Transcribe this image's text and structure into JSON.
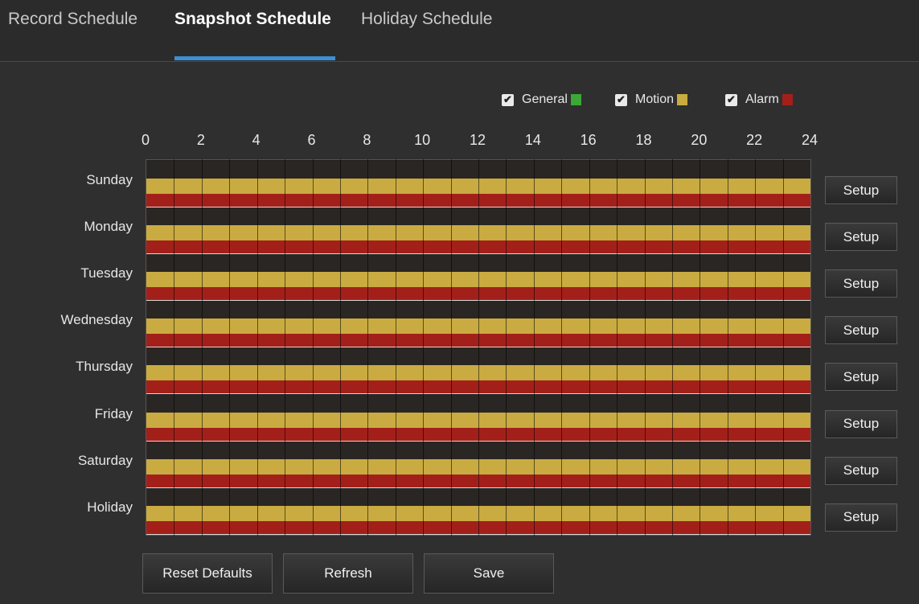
{
  "tabs": [
    {
      "label": "Record Schedule",
      "active": false
    },
    {
      "label": "Snapshot Schedule",
      "active": true
    },
    {
      "label": "Holiday Schedule",
      "active": false
    }
  ],
  "legend": [
    {
      "label": "General",
      "checked": true,
      "color": "#3aa935"
    },
    {
      "label": "Motion",
      "checked": true,
      "color": "#c9ab41"
    },
    {
      "label": "Alarm",
      "checked": true,
      "color": "#a3201a"
    }
  ],
  "axis": {
    "ticks": [
      "0",
      "2",
      "4",
      "6",
      "8",
      "10",
      "12",
      "14",
      "16",
      "18",
      "20",
      "22",
      "24"
    ]
  },
  "schedule": {
    "days": [
      {
        "label": "Sunday",
        "setup_label": "Setup",
        "motion": [
          0,
          24
        ],
        "alarm": [
          0,
          24
        ]
      },
      {
        "label": "Monday",
        "setup_label": "Setup",
        "motion": [
          0,
          24
        ],
        "alarm": [
          0,
          24
        ]
      },
      {
        "label": "Tuesday",
        "setup_label": "Setup",
        "motion": [
          0,
          24
        ],
        "alarm": [
          0,
          24
        ]
      },
      {
        "label": "Wednesday",
        "setup_label": "Setup",
        "motion": [
          0,
          24
        ],
        "alarm": [
          0,
          24
        ]
      },
      {
        "label": "Thursday",
        "setup_label": "Setup",
        "motion": [
          0,
          24
        ],
        "alarm": [
          0,
          24
        ]
      },
      {
        "label": "Friday",
        "setup_label": "Setup",
        "motion": [
          0,
          24
        ],
        "alarm": [
          0,
          24
        ]
      },
      {
        "label": "Saturday",
        "setup_label": "Setup",
        "motion": [
          0,
          24
        ],
        "alarm": [
          0,
          24
        ]
      },
      {
        "label": "Holiday",
        "setup_label": "Setup",
        "motion": [
          0,
          24
        ],
        "alarm": [
          0,
          24
        ]
      }
    ]
  },
  "buttons": {
    "reset_label": "Reset Defaults",
    "refresh_label": "Refresh",
    "save_label": "Save"
  },
  "colors": {
    "accent": "#3e8fd3",
    "motion": "#c9ab41",
    "alarm": "#a3201a",
    "general": "#3aa935"
  }
}
